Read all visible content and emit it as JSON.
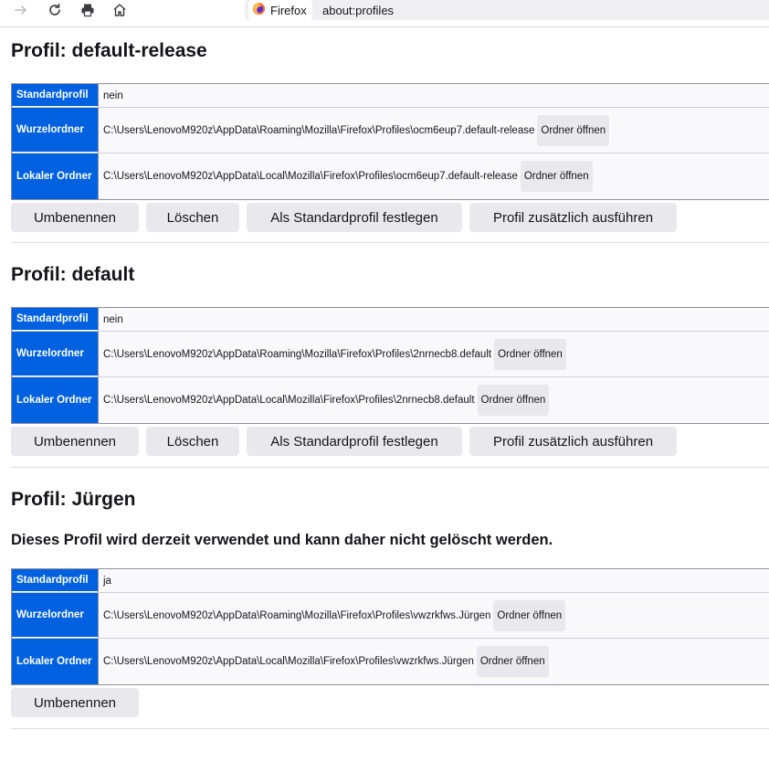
{
  "browser": {
    "tab_label": "Firefox",
    "url": "about:profiles"
  },
  "labels": {
    "default_profile": "Standardprofil",
    "root_dir": "Wurzelordner",
    "local_dir": "Lokaler Ordner",
    "open_folder": "Ordner öffnen",
    "rename": "Umbenennen",
    "delete": "Löschen",
    "set_default": "Als Standardprofil festlegen",
    "launch": "Profil zusätzlich ausführen"
  },
  "profiles": [
    {
      "title": "Profil: default-release",
      "is_default": "nein",
      "root_path": "C:\\Users\\LenovoM920z\\AppData\\Roaming\\Mozilla\\Firefox\\Profiles\\ocm6eup7.default-release",
      "local_path": "C:\\Users\\LenovoM920z\\AppData\\Local\\Mozilla\\Firefox\\Profiles\\ocm6eup7.default-release"
    },
    {
      "title": "Profil: default",
      "is_default": "nein",
      "root_path": "C:\\Users\\LenovoM920z\\AppData\\Roaming\\Mozilla\\Firefox\\Profiles\\2nrnecb8.default",
      "local_path": "C:\\Users\\LenovoM920z\\AppData\\Local\\Mozilla\\Firefox\\Profiles\\2nrnecb8.default"
    },
    {
      "title": "Profil: Jürgen",
      "note": "Dieses Profil wird derzeit verwendet und kann daher nicht gelöscht werden.",
      "is_default": "ja",
      "root_path": "C:\\Users\\LenovoM920z\\AppData\\Roaming\\Mozilla\\Firefox\\Profiles\\vwzrkfws.Jürgen",
      "local_path": "C:\\Users\\LenovoM920z\\AppData\\Local\\Mozilla\\Firefox\\Profiles\\vwzrkfws.Jürgen"
    }
  ],
  "colors": {
    "accent": "#0061e0",
    "button": "#e9e9ed"
  }
}
